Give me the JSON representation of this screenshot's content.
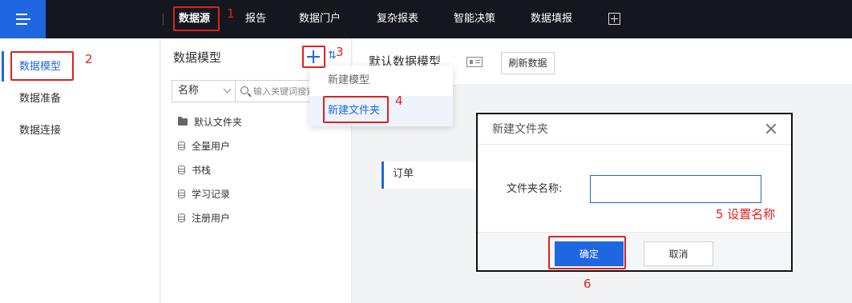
{
  "topbar": {
    "nav": [
      "数据源",
      "报告",
      "数据门户",
      "复杂报表",
      "智能决策",
      "数据填报"
    ],
    "active_index": 0,
    "accent_color": "#1f67e0"
  },
  "sidebar": {
    "items": [
      {
        "label": "数据模型",
        "active": true
      },
      {
        "label": "数据准备",
        "active": false
      },
      {
        "label": "数据连接",
        "active": false
      }
    ]
  },
  "model_panel": {
    "title": "数据模型",
    "filter_select": {
      "value": "名称"
    },
    "search": {
      "placeholder": "输入关键词搜索"
    },
    "tree": [
      {
        "label": "默认文件夹",
        "icon": "folder-icon"
      },
      {
        "label": "全量用户",
        "icon": "database-icon"
      },
      {
        "label": "书栈",
        "icon": "database-icon"
      },
      {
        "label": "学习记录",
        "icon": "database-icon"
      },
      {
        "label": "注册用户",
        "icon": "database-icon"
      }
    ]
  },
  "add_menu": {
    "items": [
      {
        "label": "新建模型"
      },
      {
        "label": "新建文件夹"
      }
    ]
  },
  "main": {
    "title": "默认数据模型",
    "refresh_label": "刷新数据",
    "card_label": "订单"
  },
  "dialog": {
    "title": "新建文件夹",
    "field_label": "文件夹名称:",
    "field_value": "",
    "ok_label": "确定",
    "cancel_label": "取消"
  },
  "annotations": {
    "n1": "1",
    "n2": "2",
    "n3": "3",
    "n4": "4",
    "n5": "5 设置名称",
    "n6": "6",
    "color": "#e02020"
  }
}
